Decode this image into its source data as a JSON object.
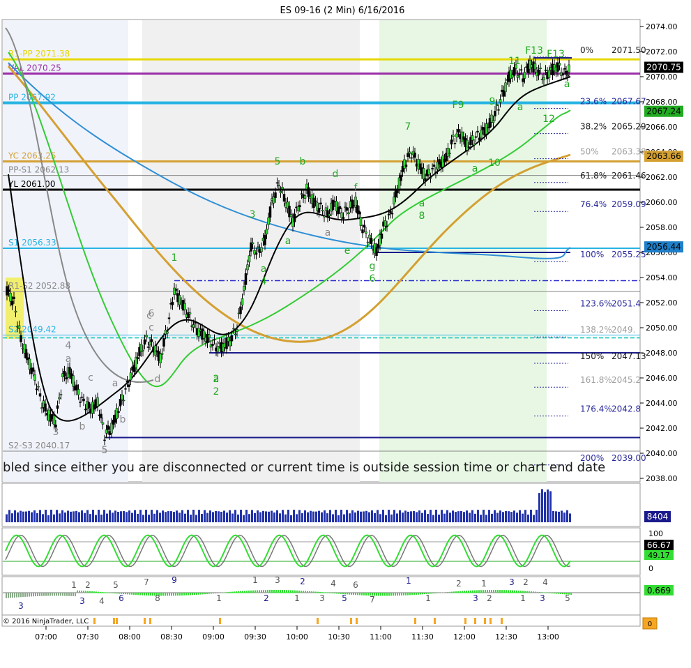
{
  "chart_data": {
    "type": "candlestick",
    "title": "ES 09-16 (2 Min)  6/16/2016",
    "copyright": "© 2016 NinjaTrader, LLC",
    "message": "bled since either you are disconnected or current time is outside session time or chart end date",
    "y_ticks": [
      "2074.00",
      "2072.00",
      "2070.00",
      "2068.00",
      "2066.00",
      "2064.00",
      "2062.00",
      "2060.00",
      "2058.00",
      "2056.00",
      "2054.00",
      "2052.00",
      "2050.00",
      "2048.00",
      "2046.00",
      "2044.00",
      "2042.00",
      "2040.00",
      "2038.00"
    ],
    "ylim": [
      2037.75,
      2074.75
    ],
    "x_ticks": [
      "07:00",
      "07:30",
      "08:00",
      "08:30",
      "09:00",
      "09:30",
      "10:00",
      "10:30",
      "11:00",
      "11:30",
      "12:00",
      "12:30",
      "13:00"
    ],
    "levels": [
      {
        "label": "R1-PP 2071.38",
        "value": 2071.38,
        "color": "#e6d800"
      },
      {
        "label": "VAL 2070.25",
        "value": 2070.25,
        "color": "#9b2fa8"
      },
      {
        "label": "PP 2067.92",
        "value": 2067.92,
        "color": "#27b4e3"
      },
      {
        "label": "YC 2063.25",
        "value": 2063.25,
        "color": "#d4a032"
      },
      {
        "label": "PP-S1 2062.13",
        "value": 2062.13,
        "color": "#888888"
      },
      {
        "label": "YL 2061.00",
        "value": 2061.0,
        "color": "#000000"
      },
      {
        "label": "S1 2056.33",
        "value": 2056.33,
        "color": "#27b4e3"
      },
      {
        "label": "R1-S2 2052.88",
        "value": 2052.88,
        "color": "#888888"
      },
      {
        "label": "S2 2049.42",
        "value": 2049.42,
        "color": "#27b4e3"
      },
      {
        "label": "S2-S3 2040.17",
        "value": 2040.17,
        "color": "#888888"
      }
    ],
    "fib_levels": [
      {
        "label": "0%",
        "price": "2071.50"
      },
      {
        "label": "23.6%",
        "price": "2067.67"
      },
      {
        "label": "38.2%",
        "price": "2065.29"
      },
      {
        "label": "50%",
        "price": "2063.38"
      },
      {
        "label": "61.8%",
        "price": "2061.46"
      },
      {
        "label": "76.4%",
        "price": "2059.09"
      },
      {
        "label": "100%",
        "price": "2055.25"
      },
      {
        "label": "123.6%",
        "price": "2051.4"
      },
      {
        "label": "138.2%",
        "price": "2049."
      },
      {
        "label": "150%",
        "price": "2047.13"
      },
      {
        "label": "161.8%",
        "price": "2045.2"
      },
      {
        "label": "176.4%",
        "price": "2042.8"
      },
      {
        "label": "200%",
        "price": "2039.00"
      }
    ],
    "price_tags": [
      {
        "text": "2070.75",
        "color": "#000000"
      },
      {
        "text": "2067.24",
        "color": "#22aa22"
      },
      {
        "text": "2063.66",
        "color": "#d4a032"
      },
      {
        "text": "2056.44",
        "color": "#1f7fc8"
      }
    ],
    "annotations": [
      "F13",
      "F13",
      "11",
      "F9",
      "9",
      "7",
      "5",
      "b",
      "d",
      "f",
      "3",
      "1",
      "6",
      "c",
      "4",
      "a",
      "2",
      "3",
      "5",
      "b",
      "c",
      "a",
      "a",
      "e",
      "g",
      "6",
      "a",
      "8",
      "a",
      "10",
      "12",
      "a",
      "a",
      "a",
      "a",
      "4",
      "a",
      "d",
      "c",
      "b",
      "5",
      "2"
    ],
    "volume": {
      "tag": "8404",
      "ticks": []
    },
    "stochastic": {
      "ticks": [
        "100",
        "0"
      ],
      "tags": [
        "66.67",
        "49.17"
      ]
    },
    "oscillator": {
      "tag": "0.669",
      "labels": [
        "3",
        "1",
        "2",
        "3",
        "4",
        "5",
        "6",
        "7",
        "8",
        "9",
        "1",
        "1",
        "2",
        "3",
        "1",
        "2",
        "3",
        "4",
        "5",
        "6",
        "7",
        "1",
        "1",
        "2",
        "3",
        "1",
        "2",
        "3",
        "1",
        "2",
        "3",
        "4",
        "5"
      ]
    },
    "bottom_tag": "0"
  }
}
